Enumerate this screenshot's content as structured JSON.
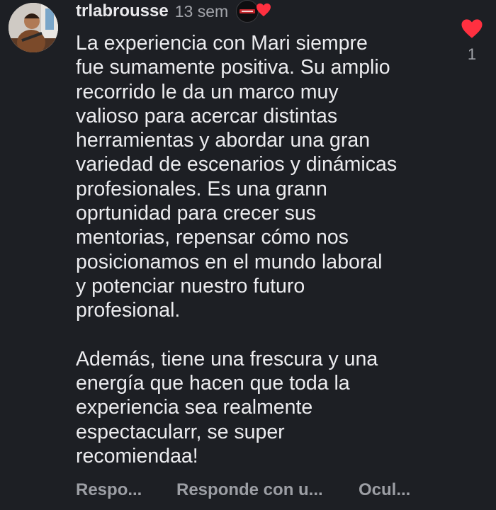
{
  "comment": {
    "username": "trlabrousse",
    "timestamp": "13 sem",
    "text": "La experiencia con Mari siempre\nfue sumamente positiva. Su amplio\nrecorrido le da un marco muy\nvalioso para acercar distintas\nherramientas y abordar una gran\nvariedad de escenarios y dinámicas\nprofesionales. Es una grann\noprtunidad para crecer sus\nmentorias, repensar cómo nos\nposicionamos en el mundo laboral\ny potenciar nuestro futuro\nprofesional.\n\nAdemás, tiene una frescura y una\nenergía que hacen que toda la\nexperiencia sea realmente\nespectacularr, se super\nrecomiendaa!",
    "like_count": "1"
  },
  "actions": {
    "reply": "Respo...",
    "reply_with": "Responde con u...",
    "hide": "Ocul..."
  },
  "icons": {
    "avatar": "user-avatar",
    "creator_badge": "creator-badge-icon",
    "creator_heart": "heart-icon",
    "like": "heart-icon"
  },
  "colors": {
    "background": "#1d1f24",
    "text": "#ececef",
    "muted": "#a3a5ab",
    "heart": "#ff3040"
  }
}
